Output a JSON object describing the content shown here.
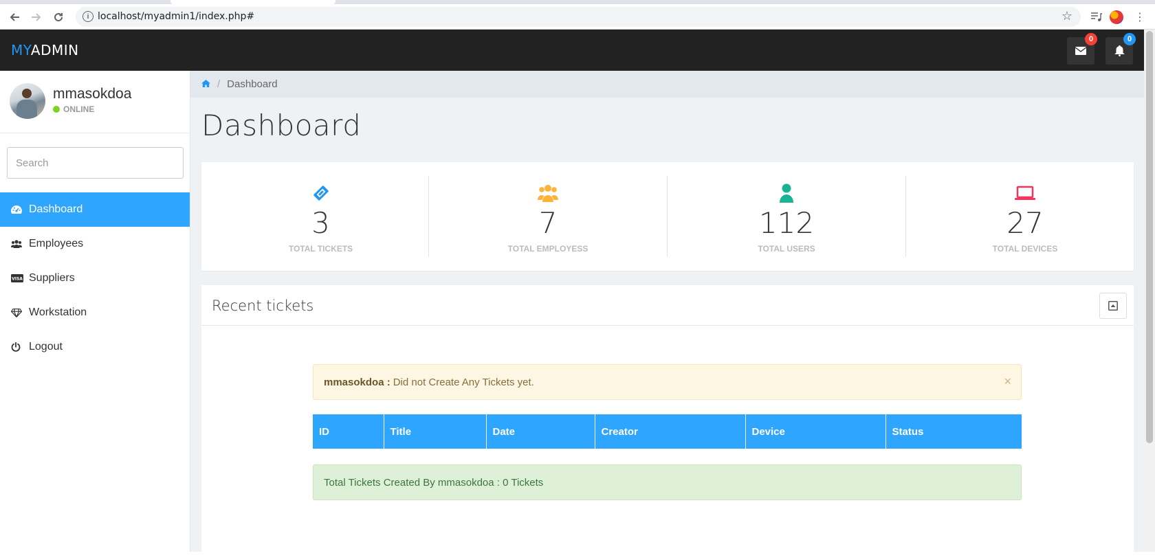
{
  "browser": {
    "url": "localhost/myadmin1/index.php#"
  },
  "topbar": {
    "brand_accent": "MY",
    "brand_rest": "ADMIN",
    "mail_count": "0",
    "notif_count": "0"
  },
  "user": {
    "name": "mmasokdoa",
    "status": "ONLINE"
  },
  "search": {
    "placeholder": "Search"
  },
  "menu": [
    {
      "label": "Dashboard",
      "icon": "dashboard-icon",
      "active": true
    },
    {
      "label": "Employees",
      "icon": "users-icon",
      "active": false
    },
    {
      "label": "Suppliers",
      "icon": "visa-card-icon",
      "active": false
    },
    {
      "label": "Workstation",
      "icon": "diamond-icon",
      "active": false
    },
    {
      "label": "Logout",
      "icon": "power-icon",
      "active": false
    }
  ],
  "breadcrumb": {
    "current": "Dashboard"
  },
  "page": {
    "title": "Dashboard"
  },
  "stats": [
    {
      "value": "3",
      "label": "TOTAL TICKETS",
      "icon": "ticket-icon",
      "color": "#2196f3"
    },
    {
      "value": "7",
      "label": "TOTAL EMPLOYESS",
      "icon": "users-icon",
      "color": "#ffb238"
    },
    {
      "value": "112",
      "label": "TOTAL USERS",
      "icon": "user-icon",
      "color": "#1ab394"
    },
    {
      "value": "27",
      "label": "TOTAL DEVICES",
      "icon": "laptop-icon",
      "color": "#f5365c"
    }
  ],
  "recent": {
    "title": "Recent tickets",
    "alert_user": "mmasokdoa :",
    "alert_text": "Did not Create Any Tickets yet.",
    "alert_close": "×",
    "columns": [
      "ID",
      "Title",
      "Date",
      "Creator",
      "Device",
      "Status"
    ],
    "summary": "Total Tickets Created By mmasokdoa : 0 Tickets"
  },
  "colors": {
    "accent": "#2ea5ff",
    "topbar": "#222222",
    "online": "#7ed321"
  }
}
